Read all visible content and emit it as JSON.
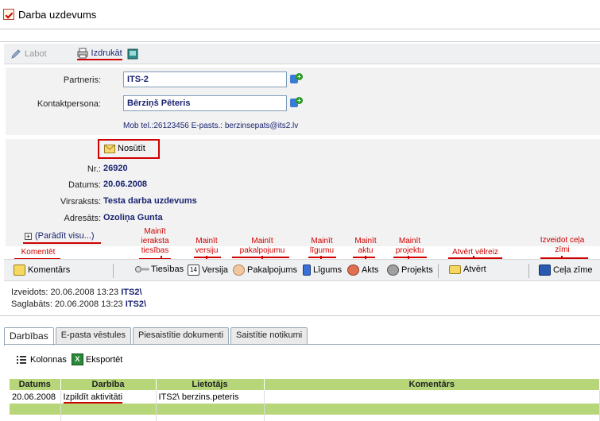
{
  "window": {
    "title": "Darba uzdevums"
  },
  "toolbar": {
    "edit_label": "Labot",
    "print_label": "Izdrukāt"
  },
  "partner": {
    "partner_label": "Partneris:",
    "partner_value": "ITS-2",
    "contact_label": "Kontaktpersona:",
    "contact_value": "Bērziņš Pēteris",
    "contact_info": "Mob tel.:26123456  E-pasts.:  berzinsepats@its2.lv"
  },
  "details": {
    "send_label": "Nosūtīt",
    "nr_label": "Nr.:",
    "nr_value": "26920",
    "date_label": "Datums:",
    "date_value": "20.06.2008",
    "subject_label": "Virsraksts:",
    "subject_value": "Testa darba uzdevums",
    "recipient_label": "Adresāts:",
    "recipient_value": "Ozoliņa Gunta",
    "show_all_label": "(Parādīt visu...)"
  },
  "annotations": {
    "comment": "Komentēt",
    "rights": "Mainīt ieraksta tiesības",
    "version": "Mainīt versiju",
    "service": "Mainīt pakalpojumu",
    "contract": "Mainīt līgumu",
    "act": "Mainīt aktu",
    "project": "Mainīt projektu",
    "reopen": "Atvērt vēlreiz",
    "route": "Izveidot ceļa zīmi"
  },
  "actions": {
    "comments": "Komentārs",
    "rights": "Tiesības",
    "version": "Versija",
    "service": "Pakalpojums",
    "contracts": "Līgums",
    "act": "Akts",
    "projects": "Projekts",
    "open": "Atvērt",
    "route": "Ceļa zīme"
  },
  "meta": {
    "created_label": "Izveidots: 20.06.2008 13:23",
    "created_user": "ITS2\\",
    "saved_label": "Saglabāts: 20.06.2008 13:23",
    "saved_user": "ITS2\\"
  },
  "tabs": [
    {
      "label": "Darbības"
    },
    {
      "label": "E-pasta vēstules"
    },
    {
      "label": "Piesaistītie dokumenti"
    },
    {
      "label": "Saistītie notikumi"
    }
  ],
  "grid_toolbar": {
    "columns_label": "Kolonnas",
    "export_label": "Eksportēt"
  },
  "grid": {
    "headers": [
      "Datums",
      "Darbība",
      "Lietotājs",
      "Komentārs"
    ],
    "rows": [
      {
        "date": "20.06.2008",
        "action": "Izpildīt aktivitāti",
        "user": "ITS2\\ berzins.peteris",
        "comment": ""
      }
    ]
  }
}
